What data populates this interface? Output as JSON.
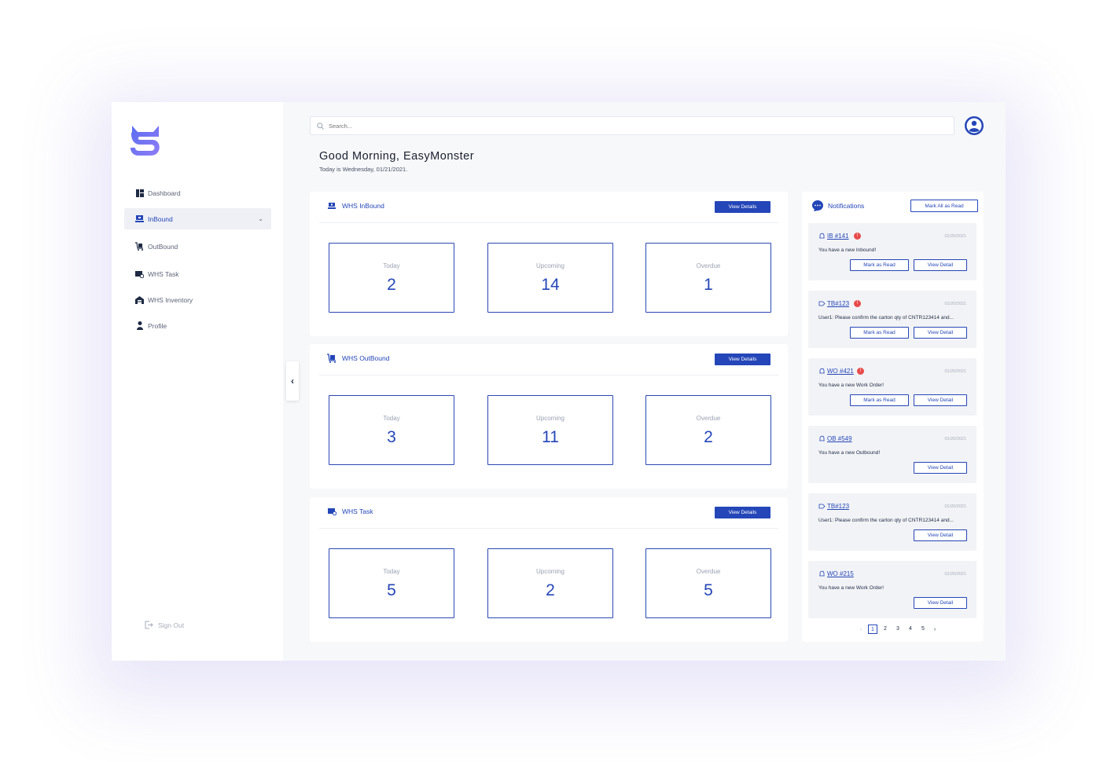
{
  "colors": {
    "accent": "#2446b8",
    "badge": "#e84b4b",
    "background": "#f7f8fa"
  },
  "sidebar": {
    "items": [
      {
        "label": "Dashboard",
        "icon": "dashboard-icon"
      },
      {
        "label": "InBound",
        "icon": "inbound-icon",
        "active": true
      },
      {
        "label": "OutBound",
        "icon": "outbound-icon"
      },
      {
        "label": "WHS Task",
        "icon": "task-icon"
      },
      {
        "label": "WHS Inventory",
        "icon": "warehouse-icon"
      },
      {
        "label": "Profile",
        "icon": "person-icon"
      }
    ],
    "sign_out": "Sign Out"
  },
  "search": {
    "placeholder": "Search..."
  },
  "greeting": {
    "title": "Good Morning, EasyMonster",
    "date": "Today is Wednesday, 01/21/2021."
  },
  "panels": [
    {
      "title": "WHS InBound",
      "button": "View Details",
      "stats": [
        {
          "label": "Today",
          "value": "2"
        },
        {
          "label": "Upcoming",
          "value": "14"
        },
        {
          "label": "Overdue",
          "value": "1"
        }
      ]
    },
    {
      "title": "WHS OutBound",
      "button": "View Details",
      "stats": [
        {
          "label": "Today",
          "value": "3"
        },
        {
          "label": "Upcoming",
          "value": "11"
        },
        {
          "label": "Overdue",
          "value": "2"
        }
      ]
    },
    {
      "title": "WHS Task",
      "button": "View Details",
      "stats": [
        {
          "label": "Today",
          "value": "5"
        },
        {
          "label": "Upcoming",
          "value": "2"
        },
        {
          "label": "Overdue",
          "value": "5"
        }
      ]
    }
  ],
  "notifications": {
    "title": "Notifications",
    "mark_all": "Mark All as Read",
    "items": [
      {
        "ref": "IB #141",
        "date": "01/20/2021",
        "message": "You have a new Inbound!",
        "mark": "Mark as Read",
        "view": "View Detail",
        "badge": "!"
      },
      {
        "ref": "TB#123",
        "date": "01/20/2021",
        "message": "User1: Please confirm the carton qty of CNTR123414 and...",
        "mark": "Mark as Read",
        "view": "View Detail",
        "badge": "!"
      },
      {
        "ref": "WO #421",
        "date": "01/20/2021",
        "message": "You have a new Work Order!",
        "mark": "Mark as Read",
        "view": "View Detail",
        "badge": "!"
      },
      {
        "ref": "OB #549",
        "date": "01/20/2021",
        "message": "You have a new Outbound!",
        "view": "View Detail"
      },
      {
        "ref": "TB#123",
        "date": "01/20/2021",
        "message": "User1: Please confirm the carton qty of CNTR123414 and...",
        "view": "View Detail"
      },
      {
        "ref": "WO #215",
        "date": "01/20/2021",
        "message": "You have a new Work Order!",
        "view": "View Detail"
      }
    ],
    "pages": [
      "1",
      "2",
      "3",
      "4",
      "5"
    ],
    "current_page": "1"
  }
}
